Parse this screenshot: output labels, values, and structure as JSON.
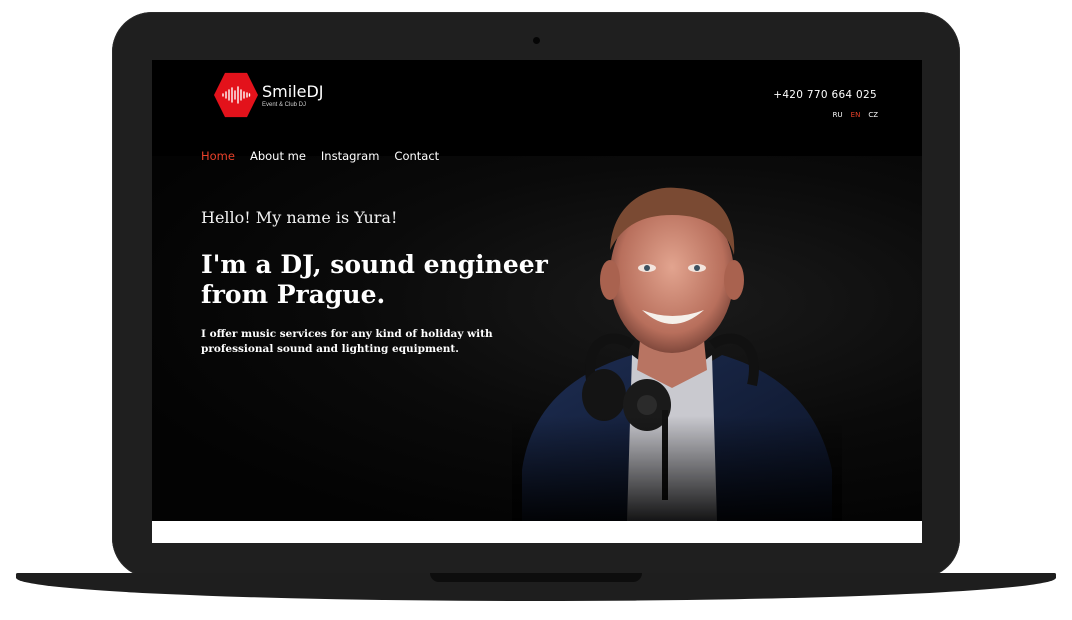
{
  "brand": {
    "name": "SmileDJ",
    "tagline": "Event & Club DJ",
    "accent_color": "#e3121b",
    "logo_icon": "soundwave-icon"
  },
  "header": {
    "phone": "+420 770 664 025",
    "languages": [
      {
        "code": "RU",
        "active": false
      },
      {
        "code": "EN",
        "active": true
      },
      {
        "code": "CZ",
        "active": false
      }
    ]
  },
  "nav": {
    "items": [
      {
        "label": "Home",
        "active": true
      },
      {
        "label": "About me",
        "active": false
      },
      {
        "label": "Instagram",
        "active": false
      },
      {
        "label": "Contact",
        "active": false
      }
    ],
    "active_color": "#e8412a"
  },
  "hero": {
    "greeting": "Hello! My name is Yura!",
    "headline": "I'm a DJ, sound engineer from Prague.",
    "description": "I offer music services for any kind of holiday with professional sound and lighting equipment."
  }
}
